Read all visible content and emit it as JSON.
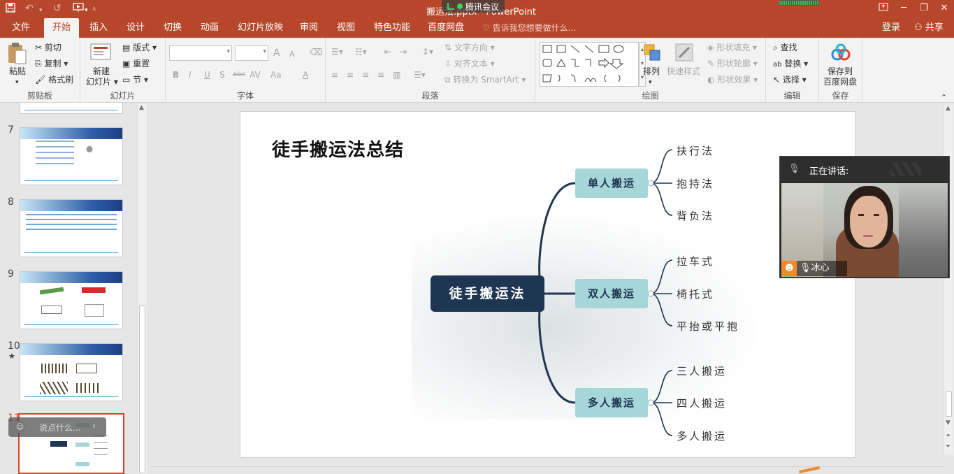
{
  "titlebar": {
    "title": "搬运法.pptx - PowerPoint",
    "meeting_label": "腾讯会议",
    "colors": {
      "accent": "#b7472a",
      "ribbon_bg": "#f3f3f3"
    }
  },
  "tabs": [
    "文件",
    "开始",
    "插入",
    "设计",
    "切换",
    "动画",
    "幻灯片放映",
    "审阅",
    "视图",
    "特色功能",
    "百度网盘"
  ],
  "active_tab": "开始",
  "tell_me": "告诉我您想要做什么...",
  "login_label": "登录",
  "share_label": "共享",
  "ribbon": {
    "clipboard": {
      "paste": "粘贴",
      "cut": "剪切",
      "copy": "复制",
      "format_painter": "格式刷",
      "label": "剪贴板"
    },
    "slides": {
      "new_slide_line1": "新建",
      "new_slide_line2": "幻灯片",
      "layout": "版式",
      "reset": "重置",
      "section": "节",
      "label": "幻灯片"
    },
    "font": {
      "label": "字体",
      "bold": "B",
      "italic": "I",
      "underline": "U",
      "shadow": "S",
      "strike": "abc",
      "spacing": "AV",
      "case": "Aa",
      "color": "A",
      "grow": "A",
      "shrink": "A"
    },
    "paragraph": {
      "label": "段落",
      "text_direction": "文字方向",
      "align_text": "对齐文本",
      "smartart": "转换为 SmartArt"
    },
    "drawing": {
      "label": "绘图",
      "arrange": "排列",
      "quick_styles": "快速样式",
      "shape_fill": "形状填充",
      "shape_outline": "形状轮廓",
      "shape_effects": "形状效果"
    },
    "editing": {
      "label": "编辑",
      "find": "查找",
      "replace": "替换",
      "select": "选择"
    },
    "save": {
      "label": "保存",
      "save_to_line1": "保存到",
      "save_to_line2": "百度网盘"
    }
  },
  "slide_panel": {
    "slide_numbers": [
      "7",
      "8",
      "9",
      "10",
      "11"
    ],
    "star_mark": "★"
  },
  "chat_overlay": {
    "placeholder": "说点什么..."
  },
  "slide": {
    "title": "徒手搬运法总结",
    "root": "徒手搬运法",
    "branches": [
      {
        "label": "单人搬运",
        "leaves": [
          "扶行法",
          "抱持法",
          "背负法"
        ]
      },
      {
        "label": "双人搬运",
        "leaves": [
          "拉车式",
          "椅托式",
          "平抬或平抱"
        ]
      },
      {
        "label": "多人搬运",
        "leaves": [
          "三人搬运",
          "四人搬运",
          "多人搬运"
        ]
      }
    ]
  },
  "video_panel": {
    "speaking_label": "正在讲话:",
    "participant_name": "冰心"
  }
}
